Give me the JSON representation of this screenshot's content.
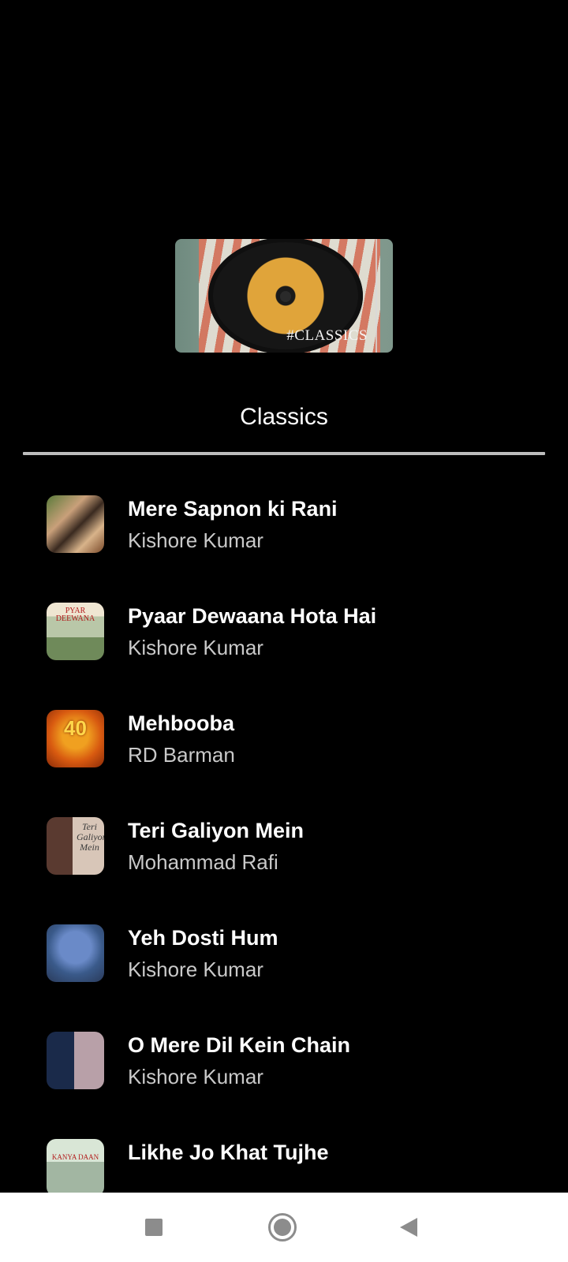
{
  "playlist": {
    "cover_label": "#CLASSICS",
    "title": "Classics"
  },
  "songs": [
    {
      "title": "Mere Sapnon ki Rani",
      "artist": "Kishore Kumar"
    },
    {
      "title": "Pyaar Dewaana Hota Hai",
      "artist": "Kishore Kumar",
      "thumb_text": "PYAR DEEWANA"
    },
    {
      "title": "Mehbooba",
      "artist": "RD Barman",
      "thumb_text": "40"
    },
    {
      "title": "Teri Galiyon Mein",
      "artist": "Mohammad Rafi",
      "thumb_text": "Teri Galiyon Mein"
    },
    {
      "title": "Yeh Dosti Hum",
      "artist": "Kishore Kumar"
    },
    {
      "title": "O Mere Dil Kein Chain",
      "artist": "Kishore Kumar"
    },
    {
      "title": "Likhe Jo Khat Tujhe",
      "artist": "",
      "thumb_text": "KANYA DAAN"
    }
  ],
  "navbar": {
    "recent_icon": "square-icon",
    "home_icon": "circle-icon",
    "back_icon": "triangle-back-icon"
  }
}
